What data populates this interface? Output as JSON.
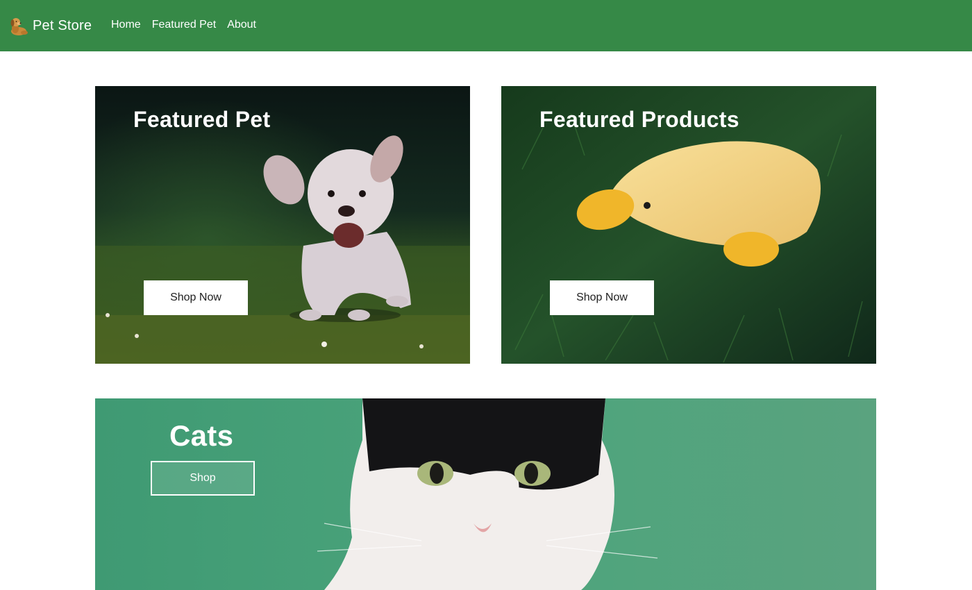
{
  "navbar": {
    "brand": {
      "logo_icon": "dog-logo-icon",
      "label": "Pet Store"
    },
    "links": [
      {
        "label": "Home"
      },
      {
        "label": "Featured Pet"
      },
      {
        "label": "About"
      }
    ],
    "background": "#368947"
  },
  "cards": {
    "featured_pet": {
      "title": "Featured Pet",
      "button": "Shop Now",
      "image": "running-dog-on-grass"
    },
    "featured_products": {
      "title": "Featured Products",
      "button": "Shop Now",
      "image": "plush-duck-toy-on-grass"
    },
    "cats": {
      "title": "Cats",
      "button": "Shop",
      "image": "black-and-white-cat-on-green-background"
    }
  }
}
